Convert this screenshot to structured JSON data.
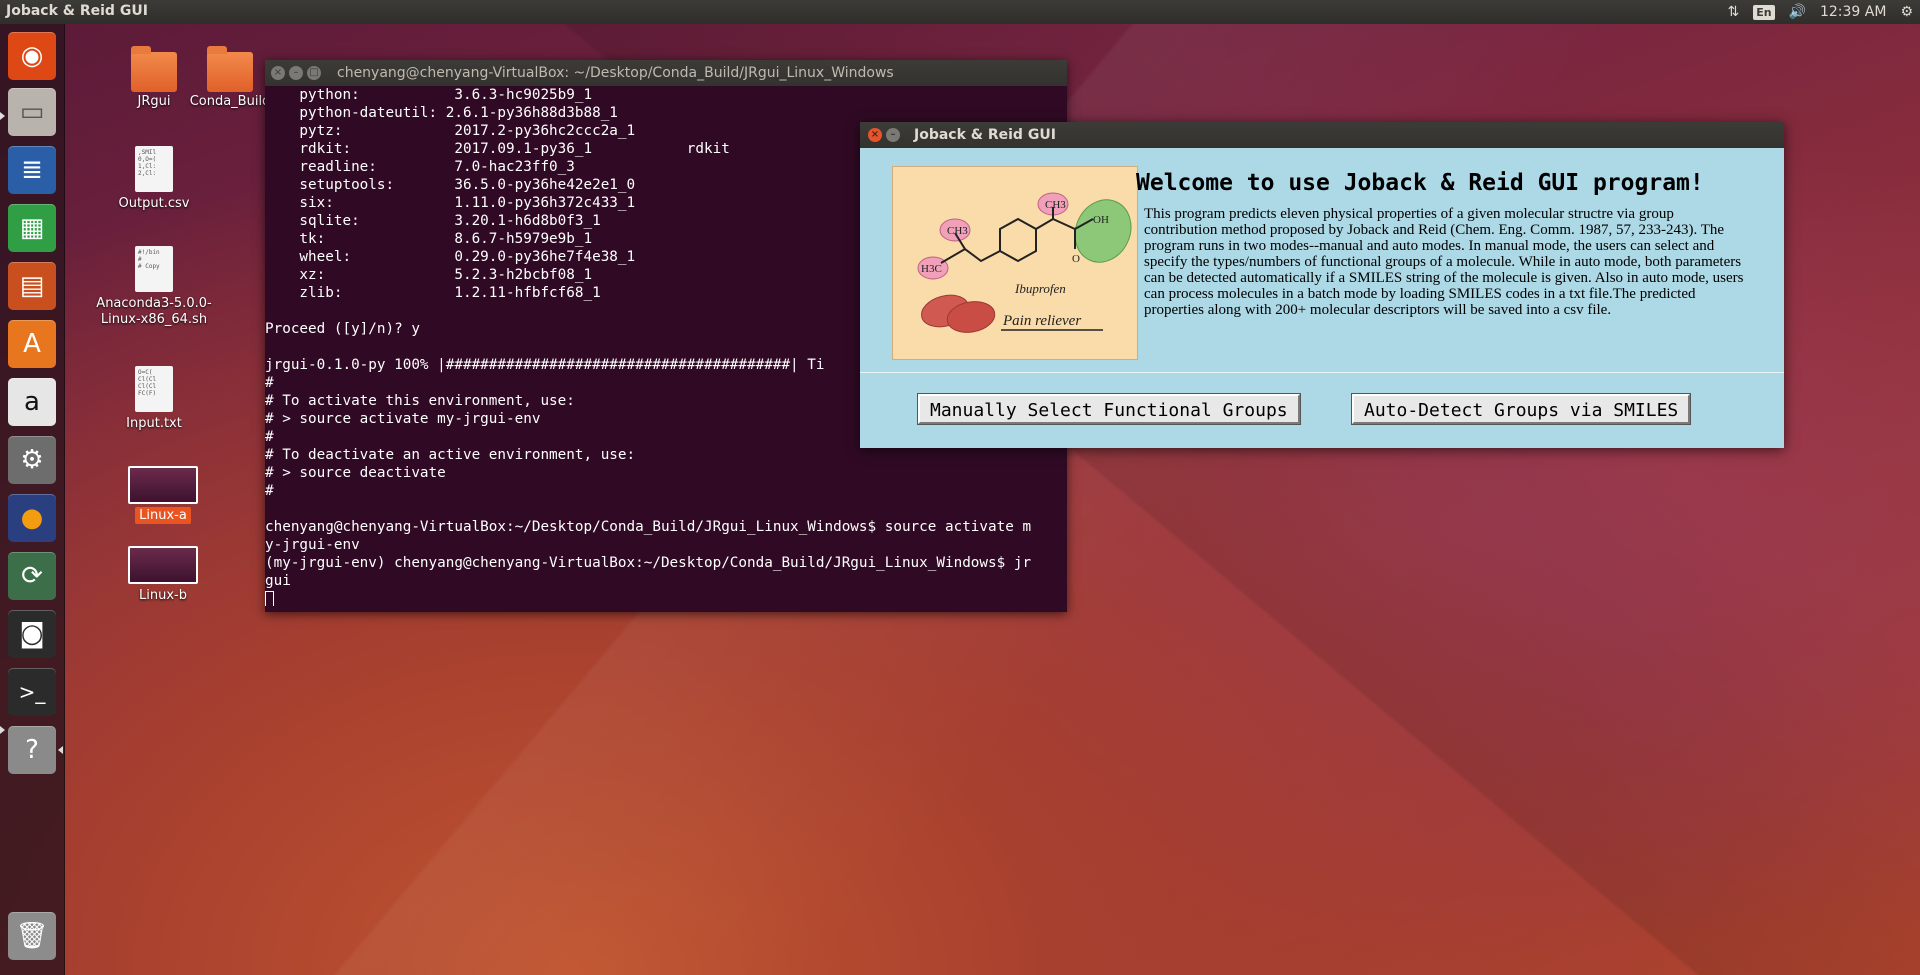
{
  "top_panel": {
    "title": "Joback & Reid GUI",
    "lang": "En",
    "time": "12:39 AM"
  },
  "desktop": {
    "icons": [
      {
        "label": "JRgui"
      },
      {
        "label": "Conda_Build"
      },
      {
        "label": "Output.csv"
      },
      {
        "label": "Anaconda3-5.0.0-Linux-x86_64.sh"
      },
      {
        "label": "Input.txt"
      },
      {
        "label": "Linux-a"
      },
      {
        "label": "Linux-b"
      }
    ]
  },
  "terminal": {
    "title": "chenyang@chenyang-VirtualBox: ~/Desktop/Conda_Build/JRgui_Linux_Windows",
    "lines": [
      "    python:           3.6.3-hc9025b9_1",
      "    python-dateutil: 2.6.1-py36h88d3b88_1",
      "    pytz:             2017.2-py36hc2ccc2a_1",
      "    rdkit:            2017.09.1-py36_1           rdkit",
      "    readline:         7.0-hac23ff0_3",
      "    setuptools:       36.5.0-py36he42e2e1_0",
      "    six:              1.11.0-py36h372c433_1",
      "    sqlite:           3.20.1-h6d8b0f3_1",
      "    tk:               8.6.7-h5979e9b_1",
      "    wheel:            0.29.0-py36he7f4e38_1",
      "    xz:               5.2.3-h2bcbf08_1",
      "    zlib:             1.2.11-hfbfcf68_1",
      "",
      "Proceed ([y]/n)? y",
      "",
      "jrgui-0.1.0-py 100% |########################################| Ti",
      "#",
      "# To activate this environment, use:",
      "# > source activate my-jrgui-env",
      "#",
      "# To deactivate an active environment, use:",
      "# > source deactivate",
      "#",
      "",
      "chenyang@chenyang-VirtualBox:~/Desktop/Conda_Build/JRgui_Linux_Windows$ source activate m",
      "y-jrgui-env",
      "(my-jrgui-env) chenyang@chenyang-VirtualBox:~/Desktop/Conda_Build/JRgui_Linux_Windows$ jr",
      "gui"
    ]
  },
  "gui": {
    "title": "Joback & Reid GUI",
    "image": {
      "molecule_label": "Ibuprofen",
      "caption": "Pain reliever",
      "ch3_a": "CH3",
      "ch3_b": "CH3",
      "h3c": "H3C",
      "oh": "OH"
    },
    "heading": "Welcome to use Joback & Reid GUI program!",
    "description": "This program predicts eleven physical properties of a given molecular structre via group contribution method proposed by Joback and Reid (Chem. Eng. Comm. 1987, 57, 233-243). The program runs in two modes--manual and auto modes. In manual mode, the users can select and specify the types/numbers of functional groups of a molecule. While in auto mode, both parameters can be detected automatically if a SMILES string of the molecule is given. Also in auto mode, users can process molecules in a batch mode by loading SMILES codes in a txt file.The predicted properties along with 200+ molecular descriptors will be saved into a csv file.",
    "manual_button": "Manually Select Functional Groups",
    "auto_button": "Auto-Detect Groups via SMILES"
  },
  "colors": {
    "accent": "#e95420",
    "gui_bg": "#add8e6",
    "terminal_bg": "#300a24"
  }
}
